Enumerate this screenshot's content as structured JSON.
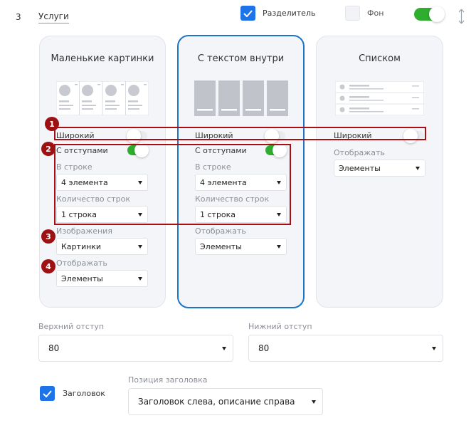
{
  "block": {
    "number": "3",
    "title": "Услуги"
  },
  "top_controls": {
    "divider_label": "Разделитель",
    "divider_checked": true,
    "background_label": "Фон",
    "background_checked": false,
    "enabled_toggle_on": true
  },
  "cards": [
    {
      "title": "Маленькие картинки",
      "selected": false,
      "wide_label": "Широкий",
      "wide_on": false,
      "padded_label": "С отступами",
      "padded_on": true,
      "per_row_label": "В строке",
      "per_row_value": "4 элемента",
      "rows_label": "Количество строк",
      "rows_value": "1 строка",
      "images_label": "Изображения",
      "images_value": "Картинки",
      "display_label": "Отображать",
      "display_value": "Элементы"
    },
    {
      "title": "С текстом внутри",
      "selected": true,
      "wide_label": "Широкий",
      "wide_on": false,
      "padded_label": "С отступами",
      "padded_on": true,
      "per_row_label": "В строке",
      "per_row_value": "4 элемента",
      "rows_label": "Количество строк",
      "rows_value": "1 строка",
      "display_label": "Отображать",
      "display_value": "Элементы"
    },
    {
      "title": "Списком",
      "selected": false,
      "wide_label": "Широкий",
      "wide_on": false,
      "display_label": "Отображать",
      "display_value": "Элементы"
    }
  ],
  "padding": {
    "top_label": "Верхний отступ",
    "top_value": "80",
    "bottom_label": "Нижний отступ",
    "bottom_value": "80"
  },
  "heading": {
    "checkbox_label": "Заголовок",
    "checked": true,
    "position_label": "Позиция заголовка",
    "position_value": "Заголовок слева, описание справа"
  },
  "annotations": [
    "1",
    "2",
    "3",
    "4"
  ],
  "colors": {
    "accent_blue": "#1e73e8",
    "toggle_green": "#2fad2f",
    "highlight_red": "#a80f12",
    "card_bg": "#f4f5f8"
  },
  "icons": [
    "check-icon",
    "resize-vertical-icon",
    "caret-down-icon"
  ]
}
